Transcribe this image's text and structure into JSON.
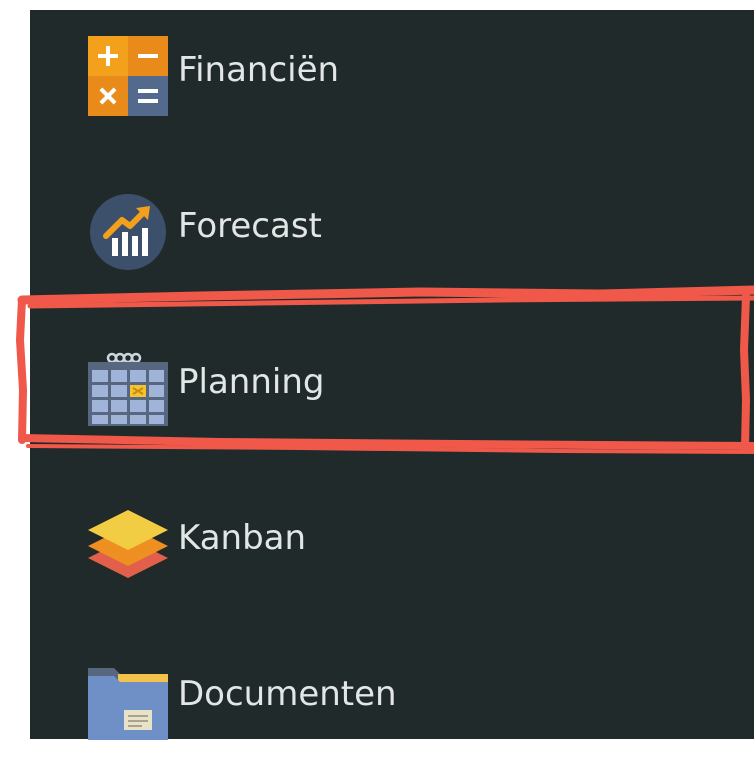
{
  "menu": {
    "items": [
      {
        "label": "Financiën",
        "icon": "calculator-icon"
      },
      {
        "label": "Forecast",
        "icon": "growth-chart-icon"
      },
      {
        "label": "Planning",
        "icon": "calendar-icon"
      },
      {
        "label": "Kanban",
        "icon": "layers-icon"
      },
      {
        "label": "Documenten",
        "icon": "folder-icon"
      }
    ],
    "highlighted_item": "Planning"
  },
  "colors": {
    "background": "#212a2a",
    "text": "#e3e6e6",
    "highlight": "#f0584a",
    "calc_orange": "#f3a11c",
    "calc_orange_dark": "#e98b1a",
    "calc_slate": "#546a8c",
    "forecast_circle": "#3c4f6b",
    "calendar_blue": "#9fb4d8",
    "calendar_frame": "#56677f",
    "calendar_mark": "#f4c430",
    "kanban_top": "#f2cc43",
    "kanban_mid": "#ee8f22",
    "kanban_bottom": "#e2604b",
    "folder_blue": "#6f8fc7",
    "folder_tab": "#f3c24a"
  }
}
